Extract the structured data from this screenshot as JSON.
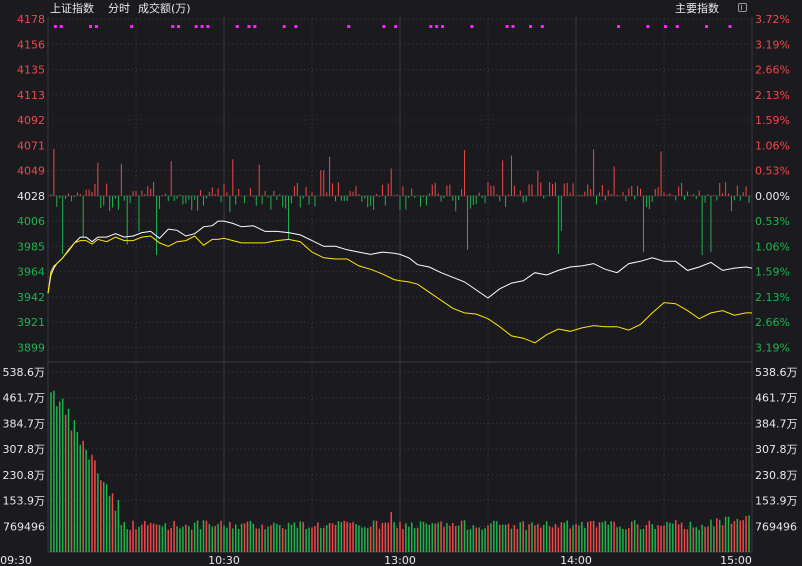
{
  "header": {
    "index_name": "上证指数",
    "mode": "分时",
    "volume_label": "成交额(万)",
    "main_index_button": "主要指数"
  },
  "colors": {
    "background": "#1b1b1f",
    "grid": "#3a3a40",
    "up": "#f04848",
    "down": "#1fb34d",
    "price_line": "#ffffff",
    "avg_line": "#ffe600",
    "marker": "#ff22ff",
    "label_neutral": "#e8e8e8"
  },
  "chart_data": {
    "type": "line",
    "price_axis": {
      "ticks": [
        4178,
        4156,
        4135,
        4113,
        4092,
        4071,
        4049,
        4028,
        4006,
        3985,
        3964,
        3942,
        3921,
        3899
      ],
      "pct_ticks": [
        "3.72%",
        "3.19%",
        "2.66%",
        "2.13%",
        "1.59%",
        "1.06%",
        "0.53%",
        "0.00%",
        "0.53%",
        "1.06%",
        "1.59%",
        "2.13%",
        "2.66%",
        "3.19%"
      ],
      "base": 4028,
      "ylim": [
        3892,
        4184
      ]
    },
    "volume_axis": {
      "ticks": [
        "538.6万",
        "461.7万",
        "384.7万",
        "307.8万",
        "230.8万",
        "153.9万",
        "769496"
      ],
      "ylim": [
        0,
        5386000
      ]
    },
    "x_ticks": [
      "09:30",
      "10:30",
      "13:00",
      "14:00",
      "15:00"
    ],
    "series": [
      {
        "key": "price",
        "x": [
          0,
          1,
          2,
          3,
          5,
          7,
          9,
          11,
          13,
          15,
          17,
          20,
          23,
          26,
          29,
          32,
          35,
          38,
          41,
          44,
          47,
          50,
          53,
          56,
          58,
          60,
          63,
          66,
          70,
          74,
          78,
          82,
          86,
          90,
          94,
          98,
          102,
          106,
          110,
          114,
          118,
          120,
          123,
          126,
          130,
          134,
          138,
          142,
          146,
          150,
          154,
          158,
          162,
          166,
          170,
          174,
          178,
          182,
          186,
          190,
          194,
          198,
          202,
          206,
          210,
          214,
          218,
          222,
          226,
          230,
          234,
          238,
          240
        ],
        "y": [
          3939,
          3955,
          3961,
          3965,
          3970,
          3976,
          3983,
          3988,
          3988,
          3984,
          3988,
          3988,
          3991,
          3988,
          3989,
          3992,
          3993,
          3987,
          3995,
          3994,
          3989,
          3991,
          3997,
          3998,
          4002,
          4002,
          4000,
          3997,
          3998,
          3993,
          3993,
          3992,
          3990,
          3985,
          3980,
          3980,
          3977,
          3975,
          3973,
          3975,
          3974,
          3973,
          3970,
          3964,
          3962,
          3957,
          3953,
          3949,
          3942,
          3935,
          3943,
          3948,
          3950,
          3957,
          3955,
          3959,
          3962,
          3963,
          3965,
          3960,
          3957,
          3965,
          3967,
          3970,
          3967,
          3967,
          3959,
          3962,
          3966,
          3959,
          3961,
          3962,
          3961
        ]
      },
      {
        "key": "average",
        "x": [
          0,
          1,
          2,
          3,
          5,
          7,
          9,
          11,
          13,
          15,
          17,
          20,
          23,
          26,
          29,
          32,
          35,
          38,
          41,
          44,
          47,
          50,
          53,
          56,
          58,
          60,
          63,
          66,
          70,
          74,
          78,
          82,
          86,
          90,
          94,
          98,
          102,
          106,
          110,
          114,
          118,
          120,
          123,
          126,
          130,
          134,
          138,
          142,
          146,
          150,
          154,
          158,
          162,
          166,
          170,
          174,
          178,
          182,
          186,
          190,
          194,
          198,
          202,
          206,
          210,
          214,
          218,
          222,
          226,
          230,
          234,
          238,
          240
        ],
        "y": [
          3939,
          3958,
          3963,
          3965,
          3970,
          3977,
          3983,
          3985,
          3985,
          3982,
          3986,
          3984,
          3988,
          3985,
          3985,
          3988,
          3989,
          3983,
          3980,
          3984,
          3985,
          3989,
          3981,
          3986,
          3986,
          3987,
          3985,
          3983,
          3983,
          3983,
          3985,
          3986,
          3984,
          3975,
          3970,
          3969,
          3969,
          3963,
          3960,
          3956,
          3951,
          3950,
          3949,
          3947,
          3940,
          3933,
          3926,
          3922,
          3921,
          3917,
          3910,
          3902,
          3900,
          3896,
          3903,
          3908,
          3906,
          3909,
          3911,
          3910,
          3910,
          3907,
          3912,
          3922,
          3931,
          3930,
          3924,
          3917,
          3922,
          3924,
          3920,
          3922,
          3922
        ]
      }
    ]
  }
}
